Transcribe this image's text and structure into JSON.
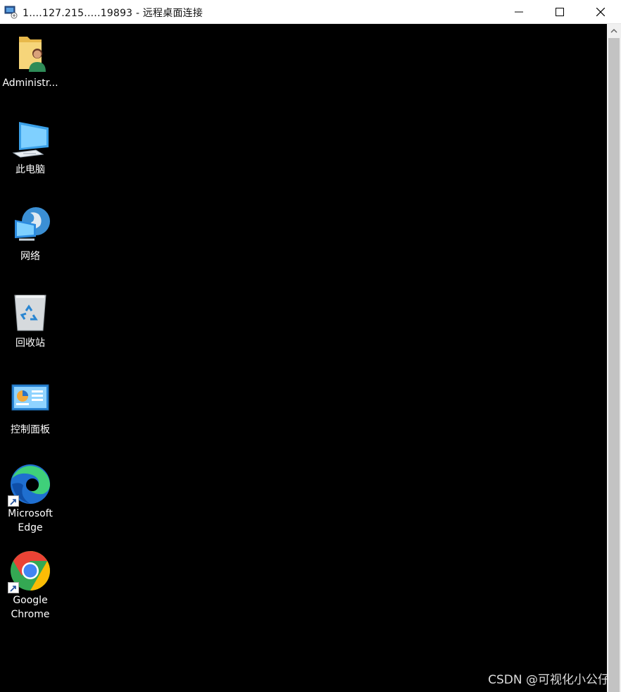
{
  "window": {
    "title_prefix": "1….127.215.….19893",
    "title_suffix": "- 远程桌面连接"
  },
  "desktop": {
    "icons": [
      {
        "label": "Administr...",
        "icon": "user-folder-icon"
      },
      {
        "label": "此电脑",
        "icon": "computer-icon"
      },
      {
        "label": "网络",
        "icon": "network-icon"
      },
      {
        "label": "回收站",
        "icon": "recycle-bin-icon"
      },
      {
        "label": "控制面板",
        "icon": "control-panel-icon"
      },
      {
        "label": "Microsoft Edge",
        "icon": "edge-icon",
        "shortcut": true
      },
      {
        "label": "Google Chrome",
        "icon": "chrome-icon",
        "shortcut": true
      }
    ]
  },
  "watermark": "CSDN @可视化小公仔",
  "colors": {
    "desktop_bg": "#000000",
    "titlebar_bg": "#ffffff",
    "scrollbar_bg": "#f0f0f0"
  }
}
